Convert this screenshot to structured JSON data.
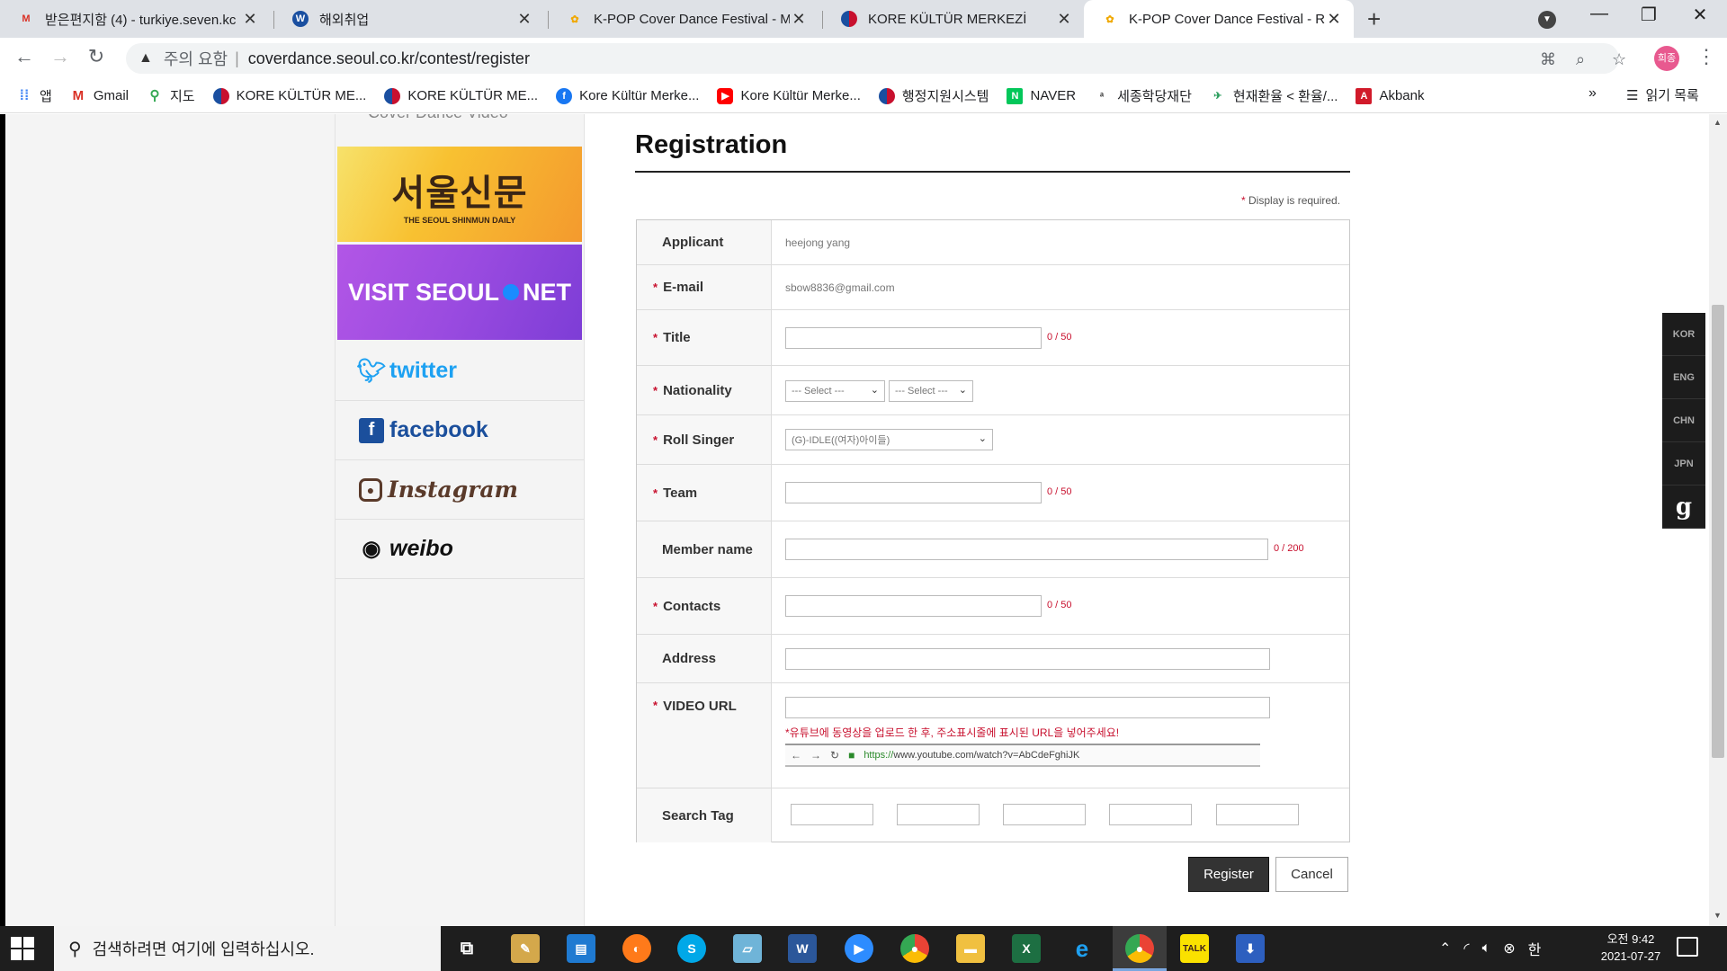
{
  "browser": {
    "tabs": [
      {
        "title": "받은편지함 (4) - turkiye.seven.kc",
        "icon": "gmail-icon",
        "active": false
      },
      {
        "title": "해외취업",
        "icon": "worldjob-icon",
        "active": false
      },
      {
        "title": "K-POP Cover Dance Festival - M",
        "icon": "kpop-icon",
        "active": false
      },
      {
        "title": "KORE KÜLTÜR MERKEZİ",
        "icon": "korea-flag-icon",
        "active": false
      },
      {
        "title": "K-POP Cover Dance Festival - R",
        "icon": "kpop-icon",
        "active": true
      }
    ],
    "security_warning": "주의 요함",
    "url_separator": "|",
    "url": "coverdance.seoul.co.kr/contest/register",
    "profile_initials": "희종",
    "bookmarks": [
      {
        "label": "앱",
        "icon": "apps-grid-icon"
      },
      {
        "label": "Gmail",
        "icon": "gmail-icon"
      },
      {
        "label": "지도",
        "icon": "maps-pin-icon"
      },
      {
        "label": "KORE KÜLTÜR ME...",
        "icon": "korea-flag-icon"
      },
      {
        "label": "KORE KÜLTÜR ME...",
        "icon": "korea-flag-icon"
      },
      {
        "label": "Kore Kültür Merke...",
        "icon": "facebook-icon"
      },
      {
        "label": "Kore Kültür Merke...",
        "icon": "youtube-icon"
      },
      {
        "label": "행정지원시스템",
        "icon": "korea-flag-icon"
      },
      {
        "label": "NAVER",
        "icon": "naver-icon"
      },
      {
        "label": "세종학당재단",
        "icon": "sejong-icon"
      },
      {
        "label": "현재환율 < 환율/...",
        "icon": "exchange-icon"
      },
      {
        "label": "Akbank",
        "icon": "akbank-icon"
      }
    ],
    "bookmarks_more": "»",
    "reading_list": "읽기 목록"
  },
  "sidebar": {
    "caption": "Cover Dance Video",
    "banners": {
      "seoul_shinmun_big": "서울신문",
      "seoul_shinmun_small": "THE SEOUL SHINMUN DAILY",
      "visit_seoul_left": "VISIT SEOUL",
      "visit_seoul_right": "NET"
    },
    "social": [
      {
        "label": "twitter",
        "icon": "twitter-icon",
        "color": "#1da1f2"
      },
      {
        "label": "facebook",
        "icon": "facebook-icon",
        "color": "#1b4f9c"
      },
      {
        "label": "Instagram",
        "icon": "instagram-icon",
        "color": "#5a3a2a"
      },
      {
        "label": "weibo",
        "icon": "weibo-icon",
        "color": "#111111"
      }
    ]
  },
  "form": {
    "title": "Registration",
    "required_note": "Display is required.",
    "applicant": {
      "label": "Applicant",
      "value": "heejong yang"
    },
    "email": {
      "label": "E-mail",
      "value": "sbow8836@gmail.com"
    },
    "title_field": {
      "label": "Title",
      "value": "",
      "counter": "0 / 50"
    },
    "nationality": {
      "label": "Nationality",
      "select1": "--- Select ---",
      "select2": "--- Select ---"
    },
    "roll_singer": {
      "label": "Roll Singer",
      "value": "(G)-IDLE((여자)아이들)"
    },
    "team": {
      "label": "Team",
      "value": "",
      "counter": "0 / 50"
    },
    "member_name": {
      "label": "Member name",
      "value": "",
      "counter": "0 / 200"
    },
    "contacts": {
      "label": "Contacts",
      "value": "",
      "counter": "0 / 50"
    },
    "address": {
      "label": "Address",
      "value": ""
    },
    "video_url": {
      "label": "VIDEO URL",
      "value": "",
      "hint": "*유튜브에 동영상을 업로드 한 후, 주소표시줄에 표시된 URL을 넣어주세요!",
      "example_scheme": "https://",
      "example_path": "www.youtube.com/watch?v=AbCdeFghiJK"
    },
    "search_tag": {
      "label": "Search Tag",
      "values": [
        "",
        "",
        "",
        "",
        ""
      ]
    },
    "register_label": "Register",
    "cancel_label": "Cancel"
  },
  "languages": [
    "KOR",
    "ENG",
    "CHN",
    "JPN",
    "g"
  ],
  "taskbar": {
    "search_placeholder": "검색하려면 여기에 입력하십시오.",
    "apps": [
      "task-view-icon",
      "paint-icon",
      "outlook-icon",
      "firefox-icon",
      "skype-icon",
      "notes-icon",
      "word-icon",
      "zoom-icon",
      "chrome-icon",
      "file-explorer-icon",
      "excel-icon",
      "ie-icon",
      "chrome-profile-icon",
      "kakaotalk-icon",
      "download-icon"
    ],
    "ime": "한",
    "time_ampm": "오전 9:42",
    "date": "2021-07-27"
  },
  "colors": {
    "accent_red": "#c8102e",
    "button_dark": "#333333"
  }
}
